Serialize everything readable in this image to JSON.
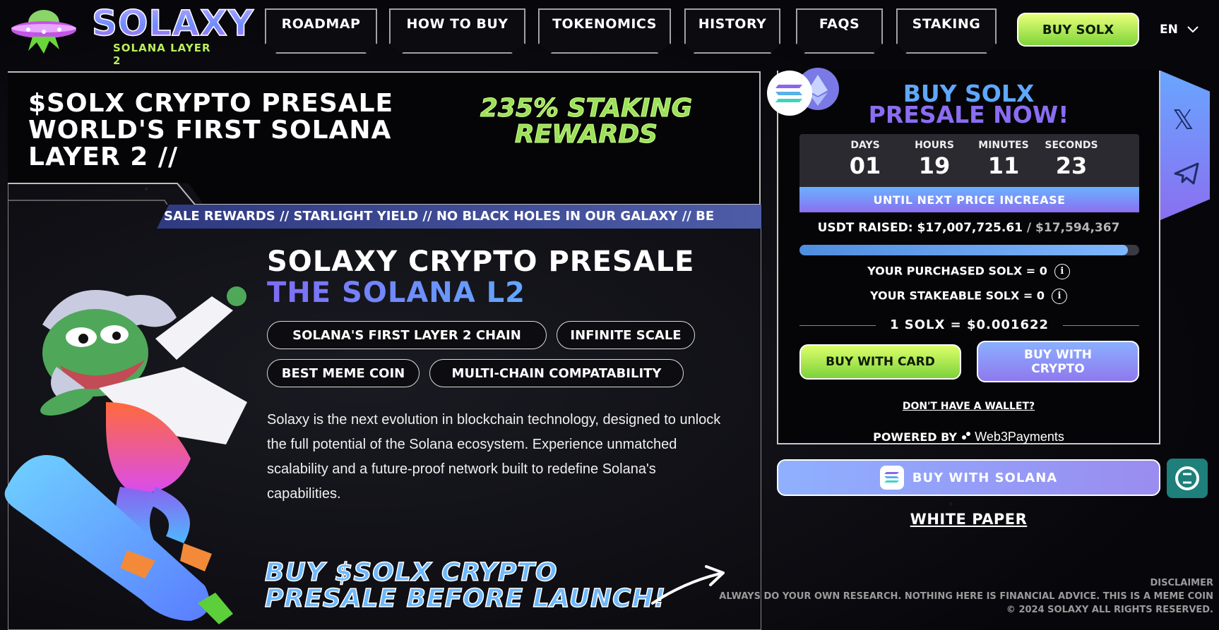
{
  "brand": {
    "name": "SOLAXY",
    "tagline": "SOLANA LAYER 2"
  },
  "nav": {
    "items": [
      "ROADMAP",
      "HOW TO BUY",
      "TOKENOMICS",
      "HISTORY",
      "FAQS",
      "STAKING"
    ],
    "buy_label": "BUY SOLX",
    "language": "EN"
  },
  "hero": {
    "headline": [
      "$SOLX CRYPTO PRESALE",
      "WORLD'S FIRST SOLANA",
      "LAYER 2 //"
    ],
    "staking": [
      "235% STAKING",
      "REWARDS"
    ],
    "ticker": "SALE REWARDS // STARLIGHT YIELD // NO BLACK HOLES IN OUR GALAXY // BE",
    "title_line1": "SOLAXY CRYPTO PRESALE",
    "title_line2": "THE SOLANA L2",
    "chips": [
      "SOLANA'S FIRST LAYER 2 CHAIN",
      "INFINITE SCALE",
      "BEST MEME COIN",
      "MULTI-CHAIN COMPATABILITY"
    ],
    "description": "Solaxy is the next evolution in blockchain technology, designed to unlock the full potential of the Solana ecosystem. Experience unmatched scalability and a future-proof network built to redefine Solana's capabilities.",
    "cta": [
      "BUY $SOLX CRYPTO",
      "PRESALE BEFORE LAUNCH!"
    ]
  },
  "widget": {
    "title_line1": "BUY SOLX",
    "title_line2": "PRESALE NOW!",
    "countdown": [
      {
        "label": "DAYS",
        "value": "01"
      },
      {
        "label": "HOURS",
        "value": "19"
      },
      {
        "label": "MINUTES",
        "value": "11"
      },
      {
        "label": "SECONDS",
        "value": "23"
      }
    ],
    "until_text": "UNTIL NEXT PRICE INCREASE",
    "raised_label": "USDT RAISED:",
    "raised_value": "$17,007,725.61",
    "raised_sep": " / ",
    "raised_goal": "$17,594,367",
    "progress_fraction": 0.967,
    "purchased": "YOUR PURCHASED SOLX = 0",
    "stakeable": "YOUR STAKEABLE SOLX = 0",
    "info_glyph": "i",
    "rate": "1 SOLX = $0.001622",
    "buy_card": "BUY WITH CARD",
    "buy_crypto_line1": "BUY WITH",
    "buy_crypto_line2": "CRYPTO",
    "no_wallet": "DON'T HAVE A WALLET?",
    "powered_by": "POWERED BY",
    "powered_brand": "Web3Payments",
    "buy_solana": "BUY WITH SOLANA",
    "white_paper": "WHITE PAPER"
  },
  "social": {
    "x_glyph": "𝕏"
  },
  "footer": {
    "disclaimer_title": "DISCLAIMER",
    "disclaimer_text": "ALWAYS DO YOUR OWN RESEARCH. NOTHING HERE IS FINANCIAL ADVICE. THIS IS A MEME COIN",
    "copyright": "© 2024 SOLAXY ALL RIGHTS RESERVED."
  },
  "colors": {
    "accent_green": "#b8ef5a",
    "accent_blue": "#5ea8ff",
    "accent_purple": "#8a6df2"
  },
  "icons": [
    "ufo-logo-icon",
    "chevron-down-icon",
    "solana-coin-icon",
    "ethereum-coin-icon",
    "info-icon",
    "x-twitter-icon",
    "telegram-icon",
    "solana-icon",
    "coin-tool-icon",
    "arrow-icon",
    "pepe-mascot-illustration"
  ]
}
